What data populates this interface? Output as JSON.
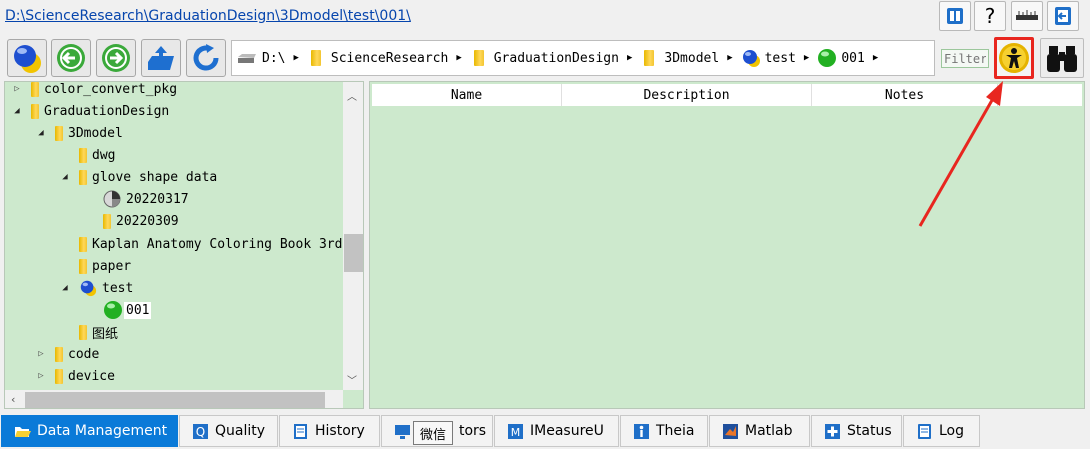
{
  "path_link": "D:\\ScienceResearch\\GraduationDesign\\3Dmodel\\test\\001\\",
  "top_buttons": [
    {
      "name": "bookmarks-button",
      "icon": "bookmark-icon"
    },
    {
      "name": "help-button",
      "label": "?",
      "icon": "question-icon"
    },
    {
      "name": "measure-button",
      "icon": "ruler-icon"
    },
    {
      "name": "login-button",
      "icon": "login-icon"
    }
  ],
  "toolbar_icons": [
    "globe-icon",
    "back-arrow-icon",
    "forward-arrow-icon",
    "upload-folder-icon",
    "refresh-icon"
  ],
  "breadcrumb": [
    {
      "label": "D:\\",
      "icon": "drive-icon"
    },
    {
      "label": "ScienceResearch",
      "icon": "folder-icon"
    },
    {
      "label": "GraduationDesign",
      "icon": "folder-icon"
    },
    {
      "label": "3Dmodel",
      "icon": "folder-icon"
    },
    {
      "label": "test",
      "icon": "globe-small-icon"
    },
    {
      "label": "001",
      "icon": "green-ball-icon"
    }
  ],
  "filter_placeholder": "Filter",
  "tree": [
    {
      "label": "color_convert_pkg",
      "icon": "folder-icon",
      "level": 0,
      "toggle": "collapsed"
    },
    {
      "label": "GraduationDesign",
      "icon": "folder-icon",
      "level": 0,
      "toggle": "expanded"
    },
    {
      "label": "3Dmodel",
      "icon": "folder-icon",
      "level": 1,
      "toggle": "expanded"
    },
    {
      "label": "dwg",
      "icon": "folder-icon",
      "level": 2,
      "toggle": "none"
    },
    {
      "label": "glove shape data",
      "icon": "folder-icon",
      "level": 2,
      "toggle": "expanded"
    },
    {
      "label": "20220317",
      "icon": "pie-icon",
      "level": 3,
      "toggle": "none"
    },
    {
      "label": "20220309",
      "icon": "folder-icon",
      "level": 3,
      "toggle": "none"
    },
    {
      "label": "Kaplan Anatomy Coloring Book 3rdE",
      "icon": "folder-icon",
      "level": 2,
      "toggle": "none"
    },
    {
      "label": "paper",
      "icon": "folder-icon",
      "level": 2,
      "toggle": "none"
    },
    {
      "label": "test",
      "icon": "globe-small-icon",
      "level": 2,
      "toggle": "expanded"
    },
    {
      "label": "001",
      "icon": "green-ball-icon",
      "level": 3,
      "toggle": "none",
      "selected": true
    },
    {
      "label": "图纸",
      "icon": "folder-icon",
      "level": 2,
      "toggle": "none"
    },
    {
      "label": "code",
      "icon": "folder-icon",
      "level": 1,
      "toggle": "collapsed"
    },
    {
      "label": "device",
      "icon": "folder-icon",
      "level": 1,
      "toggle": "collapsed"
    }
  ],
  "list_columns": [
    "Name",
    "Description",
    "Notes"
  ],
  "tabs": [
    {
      "label": "Data Management",
      "icon": "folder-open-icon",
      "active": true
    },
    {
      "label": "Quality",
      "icon": "quality-icon"
    },
    {
      "label": "History",
      "icon": "history-icon"
    },
    {
      "label": "tors",
      "icon": "monitor-icon"
    },
    {
      "label": "IMeasureU",
      "icon": "imeasureu-icon"
    },
    {
      "label": "Theia",
      "icon": "theia-icon"
    },
    {
      "label": "Matlab",
      "icon": "matlab-icon"
    },
    {
      "label": "Status",
      "icon": "plus-icon"
    },
    {
      "label": "Log",
      "icon": "log-icon"
    }
  ],
  "tooltip": "微信",
  "colors": {
    "accent": "#0a7ad8",
    "panel": "#cde9cd",
    "highlight": "#e8261f"
  }
}
